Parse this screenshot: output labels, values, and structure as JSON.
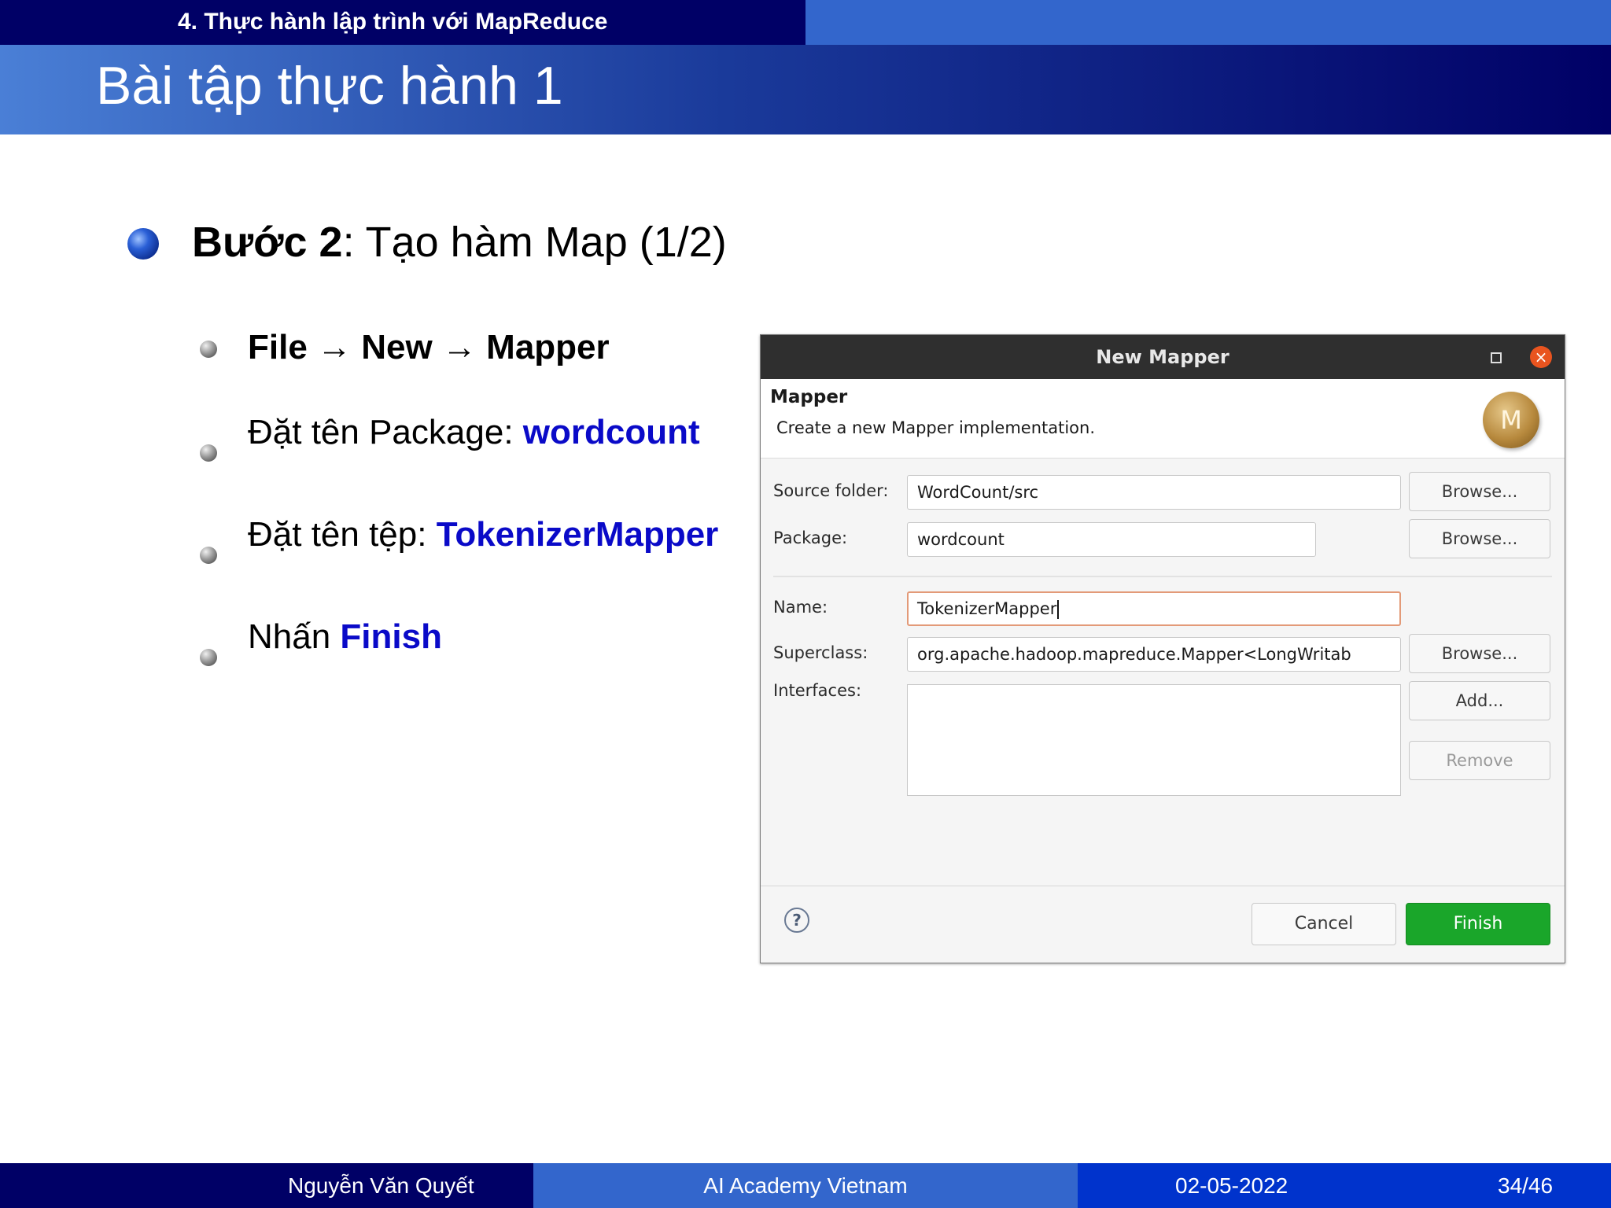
{
  "header": {
    "section": "4. Thực hành lập trình với MapReduce",
    "title": "Bài tập thực hành 1"
  },
  "main_bullet": {
    "bold": "Bước 2",
    "rest": ": Tạo hàm Map (1/2)"
  },
  "sub_bullets": {
    "menu_path": "File → New → Mapper",
    "package_prefix": "Đặt tên Package: ",
    "package_value": "wordcount",
    "file_prefix": "Đặt tên tệp: ",
    "file_value": "TokenizerMapper",
    "press_prefix": "Nhấn ",
    "press_value": "Finish"
  },
  "dialog": {
    "window_title": "New Mapper",
    "close_glyph": "×",
    "header_title": "Mapper",
    "header_desc": "Create a new Mapper implementation.",
    "badge_letter": "M",
    "source_folder_label": "Source folder:",
    "source_folder_value": "WordCount/src",
    "package_label": "Package:",
    "package_value": "wordcount",
    "name_label": "Name:",
    "name_value": "TokenizerMapper",
    "superclass_label": "Superclass:",
    "superclass_value": "org.apache.hadoop.mapreduce.Mapper<LongWritab",
    "interfaces_label": "Interfaces:",
    "browse_label": "Browse...",
    "add_label": "Add...",
    "remove_label": "Remove",
    "help_glyph": "?",
    "cancel_label": "Cancel",
    "finish_label": "Finish"
  },
  "footer": {
    "author": "Nguyễn Văn Quyết",
    "org": "AI Academy Vietnam",
    "date": "02-05-2022",
    "page": "34/46"
  }
}
